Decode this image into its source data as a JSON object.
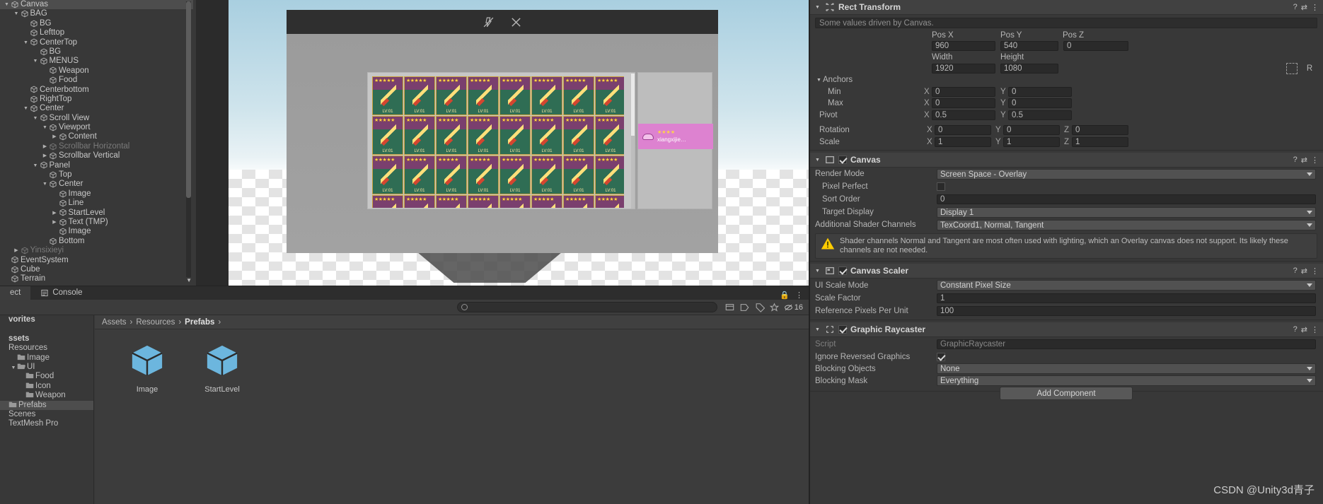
{
  "hierarchy": {
    "panel_name": "Hierarchy",
    "items": [
      {
        "label": "Canvas",
        "depth": 0,
        "arrow": "down",
        "selected": true,
        "dim": false
      },
      {
        "label": "BAG",
        "depth": 1,
        "arrow": "down",
        "selected": false,
        "dim": false
      },
      {
        "label": "BG",
        "depth": 2,
        "arrow": "none",
        "selected": false,
        "dim": false
      },
      {
        "label": "Lefttop",
        "depth": 2,
        "arrow": "none",
        "selected": false,
        "dim": false
      },
      {
        "label": "CenterTop",
        "depth": 2,
        "arrow": "down",
        "selected": false,
        "dim": false
      },
      {
        "label": "BG",
        "depth": 3,
        "arrow": "none",
        "selected": false,
        "dim": false
      },
      {
        "label": "MENUS",
        "depth": 3,
        "arrow": "down",
        "selected": false,
        "dim": false
      },
      {
        "label": "Weapon",
        "depth": 4,
        "arrow": "none",
        "selected": false,
        "dim": false
      },
      {
        "label": "Food",
        "depth": 4,
        "arrow": "none",
        "selected": false,
        "dim": false
      },
      {
        "label": "Centerbottom",
        "depth": 2,
        "arrow": "none",
        "selected": false,
        "dim": false
      },
      {
        "label": "RightTop",
        "depth": 2,
        "arrow": "none",
        "selected": false,
        "dim": false
      },
      {
        "label": "Center",
        "depth": 2,
        "arrow": "down",
        "selected": false,
        "dim": false
      },
      {
        "label": "Scroll View",
        "depth": 3,
        "arrow": "down",
        "selected": false,
        "dim": false
      },
      {
        "label": "Viewport",
        "depth": 4,
        "arrow": "down",
        "selected": false,
        "dim": false
      },
      {
        "label": "Content",
        "depth": 5,
        "arrow": "right",
        "selected": false,
        "dim": false
      },
      {
        "label": "Scrollbar Horizontal",
        "depth": 4,
        "arrow": "right",
        "selected": false,
        "dim": true
      },
      {
        "label": "Scrollbar Vertical",
        "depth": 4,
        "arrow": "right",
        "selected": false,
        "dim": false
      },
      {
        "label": "Panel",
        "depth": 3,
        "arrow": "down",
        "selected": false,
        "dim": false
      },
      {
        "label": "Top",
        "depth": 4,
        "arrow": "none",
        "selected": false,
        "dim": false
      },
      {
        "label": "Center",
        "depth": 4,
        "arrow": "down",
        "selected": false,
        "dim": false
      },
      {
        "label": "Image",
        "depth": 5,
        "arrow": "none",
        "selected": false,
        "dim": false
      },
      {
        "label": "Line",
        "depth": 5,
        "arrow": "none",
        "selected": false,
        "dim": false
      },
      {
        "label": "StartLevel",
        "depth": 5,
        "arrow": "right",
        "selected": false,
        "dim": false
      },
      {
        "label": "Text (TMP)",
        "depth": 5,
        "arrow": "right",
        "selected": false,
        "dim": false
      },
      {
        "label": "Image",
        "depth": 5,
        "arrow": "none",
        "selected": false,
        "dim": false
      },
      {
        "label": "Bottom",
        "depth": 4,
        "arrow": "none",
        "selected": false,
        "dim": false
      },
      {
        "label": "Yinsixieyi",
        "depth": 1,
        "arrow": "right",
        "selected": false,
        "dim": true
      },
      {
        "label": "EventSystem",
        "depth": 0,
        "arrow": "none",
        "selected": false,
        "dim": false
      },
      {
        "label": "Cube",
        "depth": 0,
        "arrow": "none",
        "selected": false,
        "dim": false
      },
      {
        "label": "Terrain",
        "depth": 0,
        "arrow": "none",
        "selected": false,
        "dim": false
      }
    ]
  },
  "scene": {
    "toolbar_icons": [
      "lighting-off-icon",
      "audio-off-icon"
    ],
    "item_level_label": "LV:01",
    "item_count": 32,
    "detail": {
      "name": "xiangxijie…",
      "stars": "★★★★"
    }
  },
  "inspector": {
    "rect_transform": {
      "title": "Rect Transform",
      "driven_note": "Some values driven by Canvas.",
      "pos_labels": [
        "Pos X",
        "Pos Y",
        "Pos Z"
      ],
      "pos_values": [
        "960",
        "540",
        "0"
      ],
      "size_labels": [
        "Width",
        "Height"
      ],
      "size_values": [
        "1920",
        "1080"
      ],
      "blueprint_label": "",
      "raw_label": "R",
      "anchors_label": "Anchors",
      "min_label": "Min",
      "min": {
        "x": "0",
        "y": "0"
      },
      "max_label": "Max",
      "max": {
        "x": "0",
        "y": "0"
      },
      "pivot_label": "Pivot",
      "pivot": {
        "x": "0.5",
        "y": "0.5"
      },
      "rotation_label": "Rotation",
      "rotation": {
        "x": "0",
        "y": "0",
        "z": "0"
      },
      "scale_label": "Scale",
      "scale": {
        "x": "1",
        "y": "1",
        "z": "1"
      }
    },
    "canvas": {
      "title": "Canvas",
      "enabled": true,
      "render_mode_label": "Render Mode",
      "render_mode_value": "Screen Space - Overlay",
      "pixel_perfect_label": "Pixel Perfect",
      "pixel_perfect_checked": false,
      "sort_order_label": "Sort Order",
      "sort_order_value": "0",
      "target_display_label": "Target Display",
      "target_display_value": "Display 1",
      "shader_channels_label": "Additional Shader Channels",
      "shader_channels_value": "TexCoord1, Normal, Tangent",
      "warning": "Shader channels Normal and Tangent are most often used with lighting, which an Overlay canvas does not support. Its likely these channels are not needed."
    },
    "canvas_scaler": {
      "title": "Canvas Scaler",
      "enabled": true,
      "ui_scale_mode_label": "UI Scale Mode",
      "ui_scale_mode_value": "Constant Pixel Size",
      "scale_factor_label": "Scale Factor",
      "scale_factor_value": "1",
      "ref_ppu_label": "Reference Pixels Per Unit",
      "ref_ppu_value": "100"
    },
    "graphic_raycaster": {
      "title": "Graphic Raycaster",
      "enabled": true,
      "script_label": "Script",
      "script_value": "GraphicRaycaster",
      "ignore_reversed_label": "Ignore Reversed Graphics",
      "ignore_reversed_checked": true,
      "blocking_objects_label": "Blocking Objects",
      "blocking_objects_value": "None",
      "blocking_mask_label": "Blocking Mask",
      "blocking_mask_value": "Everything"
    },
    "add_component_label": "Add Component"
  },
  "bottom": {
    "tabs": [
      {
        "label": "ect",
        "active": true,
        "icon": "project-icon"
      },
      {
        "label": "Console",
        "active": false,
        "icon": "console-icon"
      }
    ],
    "toolbar": {
      "search_placeholder": "",
      "search_value": "",
      "warning_count": "16"
    },
    "project_tree": [
      {
        "label": "vorites",
        "depth": 0,
        "arrow": "none",
        "bold": true,
        "folder": false,
        "selected": false
      },
      {
        "label": "",
        "depth": 0,
        "arrow": "none",
        "bold": false,
        "folder": false,
        "selected": false
      },
      {
        "label": "ssets",
        "depth": 0,
        "arrow": "none",
        "bold": true,
        "folder": false,
        "selected": false
      },
      {
        "label": "Resources",
        "depth": 0,
        "arrow": "none",
        "bold": false,
        "folder": false,
        "selected": false
      },
      {
        "label": "Image",
        "depth": 1,
        "arrow": "none",
        "bold": false,
        "folder": true,
        "selected": false
      },
      {
        "label": "UI",
        "depth": 1,
        "arrow": "down",
        "bold": false,
        "folder": true,
        "selected": false
      },
      {
        "label": "Food",
        "depth": 2,
        "arrow": "none",
        "bold": false,
        "folder": true,
        "selected": false
      },
      {
        "label": "Icon",
        "depth": 2,
        "arrow": "none",
        "bold": false,
        "folder": true,
        "selected": false
      },
      {
        "label": "Weapon",
        "depth": 2,
        "arrow": "none",
        "bold": false,
        "folder": true,
        "selected": false
      },
      {
        "label": "Prefabs",
        "depth": 0,
        "arrow": "none",
        "bold": false,
        "folder": true,
        "selected": true
      },
      {
        "label": "Scenes",
        "depth": 0,
        "arrow": "none",
        "bold": false,
        "folder": false,
        "selected": false
      },
      {
        "label": "TextMesh Pro",
        "depth": 0,
        "arrow": "none",
        "bold": false,
        "folder": false,
        "selected": false
      }
    ],
    "breadcrumb": [
      "Assets",
      "Resources",
      "Prefabs"
    ],
    "assets": [
      {
        "label": "Image",
        "icon": "prefab-cube-icon"
      },
      {
        "label": "StartLevel",
        "icon": "prefab-cube-icon"
      }
    ]
  },
  "watermark": "CSDN @Unity3d青子",
  "colors": {
    "panel_bg": "#383838",
    "header_bg": "#414141",
    "selection": "#4d4d4d",
    "prefab_blue": "#6cb6de",
    "warning_yellow": "#ffcc00",
    "detail_pink": "#dd82d0"
  }
}
